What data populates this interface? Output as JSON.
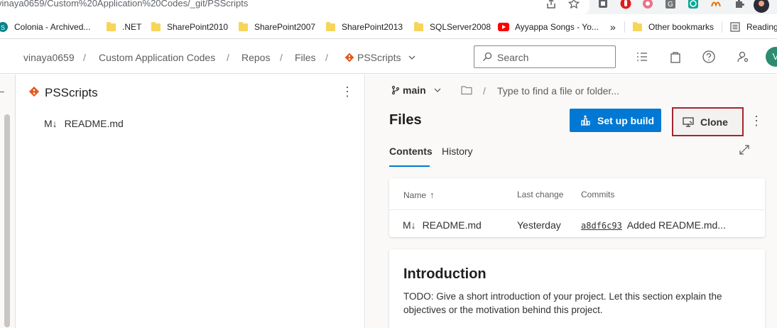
{
  "browser": {
    "url": "vinaya0659/Custom%20Application%20Codes/_git/PSScripts",
    "bookmarks": [
      {
        "label": "Colonia - Archived...",
        "icon": "sharepoint-icon"
      },
      {
        "label": ".NET",
        "icon": "folder-icon"
      },
      {
        "label": "SharePoint2010",
        "icon": "folder-icon"
      },
      {
        "label": "SharePoint2007",
        "icon": "folder-icon"
      },
      {
        "label": "SharePoint2013",
        "icon": "folder-icon"
      },
      {
        "label": "SQLServer2008",
        "icon": "folder-icon"
      },
      {
        "label": "Ayyappa Songs - Yo...",
        "icon": "youtube-icon"
      }
    ],
    "overflow_label": "»",
    "other_bookmarks": "Other bookmarks",
    "reading_list": "Reading"
  },
  "header": {
    "breadcrumbs": [
      "vinaya0659",
      "Custom Application Codes",
      "Repos",
      "Files",
      "PSScripts"
    ],
    "separator": "/",
    "search_placeholder": "Search",
    "avatar_initial": "V"
  },
  "left_pane": {
    "repo_name": "PSScripts",
    "tree_items": [
      {
        "icon_text": "M↓",
        "name": "README.md"
      }
    ]
  },
  "right_pane": {
    "branch": "main",
    "path_placeholder": "Type to find a file or folder...",
    "path_separator": "/",
    "title": "Files",
    "setup_build_label": "Set up build",
    "clone_label": "Clone",
    "tabs": [
      "Contents",
      "History"
    ],
    "table": {
      "headers": [
        "Name",
        "Last change",
        "Commits"
      ],
      "sort_arrow": "↑",
      "rows": [
        {
          "icon_text": "M↓",
          "name": "README.md",
          "last_change": "Yesterday",
          "commit_id": "a8df6c93",
          "commit_msg": "Added README.md..."
        }
      ]
    },
    "readme": {
      "heading": "Introduction",
      "body": "TODO: Give a short introduction of your project. Let this section explain the objectives or the motivation behind this project."
    }
  },
  "colors": {
    "primary": "#0078d4",
    "highlight_border": "#a4262c",
    "git_orange": "#e15a1f",
    "avatar_bg": "#2e8b70"
  }
}
